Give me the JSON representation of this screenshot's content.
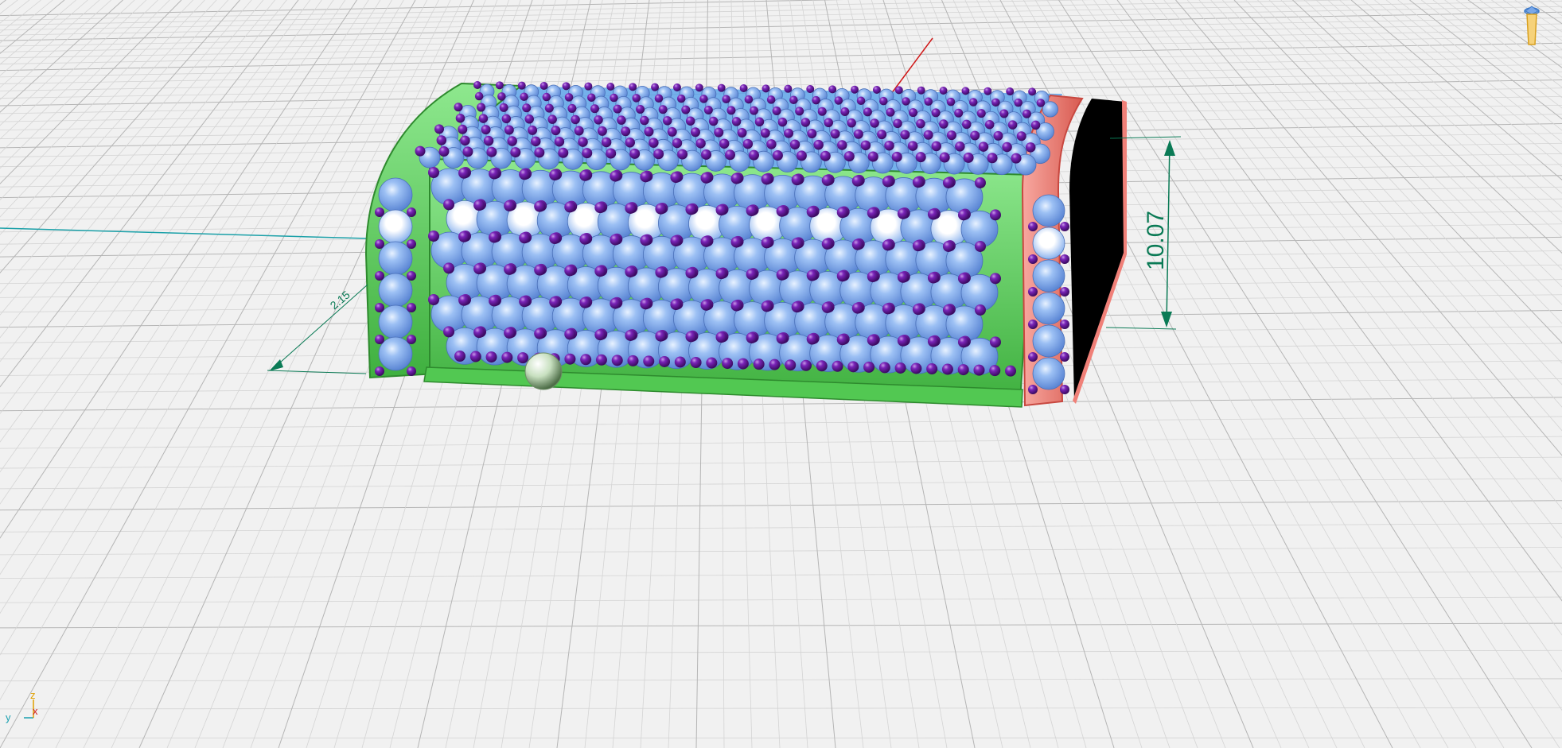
{
  "viewport": {
    "background": "#f1f1f1",
    "grid_major_color": "#b8b8b8",
    "grid_minor_color": "#d8d8d8"
  },
  "model": {
    "body_color": "#5fd25f",
    "end_color": "#f08078",
    "stone_color": "#7ea7e8",
    "prong_color": "#6a1aa0",
    "ball_color": "#c8e0c0"
  },
  "dimensions": {
    "height": {
      "label": "10.07",
      "color": "#0a7a55"
    },
    "depth": {
      "label": "2.15",
      "color": "#0a7a55"
    }
  },
  "axes_indicator": {
    "z": "z",
    "y": "y",
    "x": "x",
    "z_color": "#e0a000",
    "y_color": "#1aa0b0",
    "x_color": "#d02020"
  },
  "view_cube": {
    "name": "view-cube-icon"
  }
}
